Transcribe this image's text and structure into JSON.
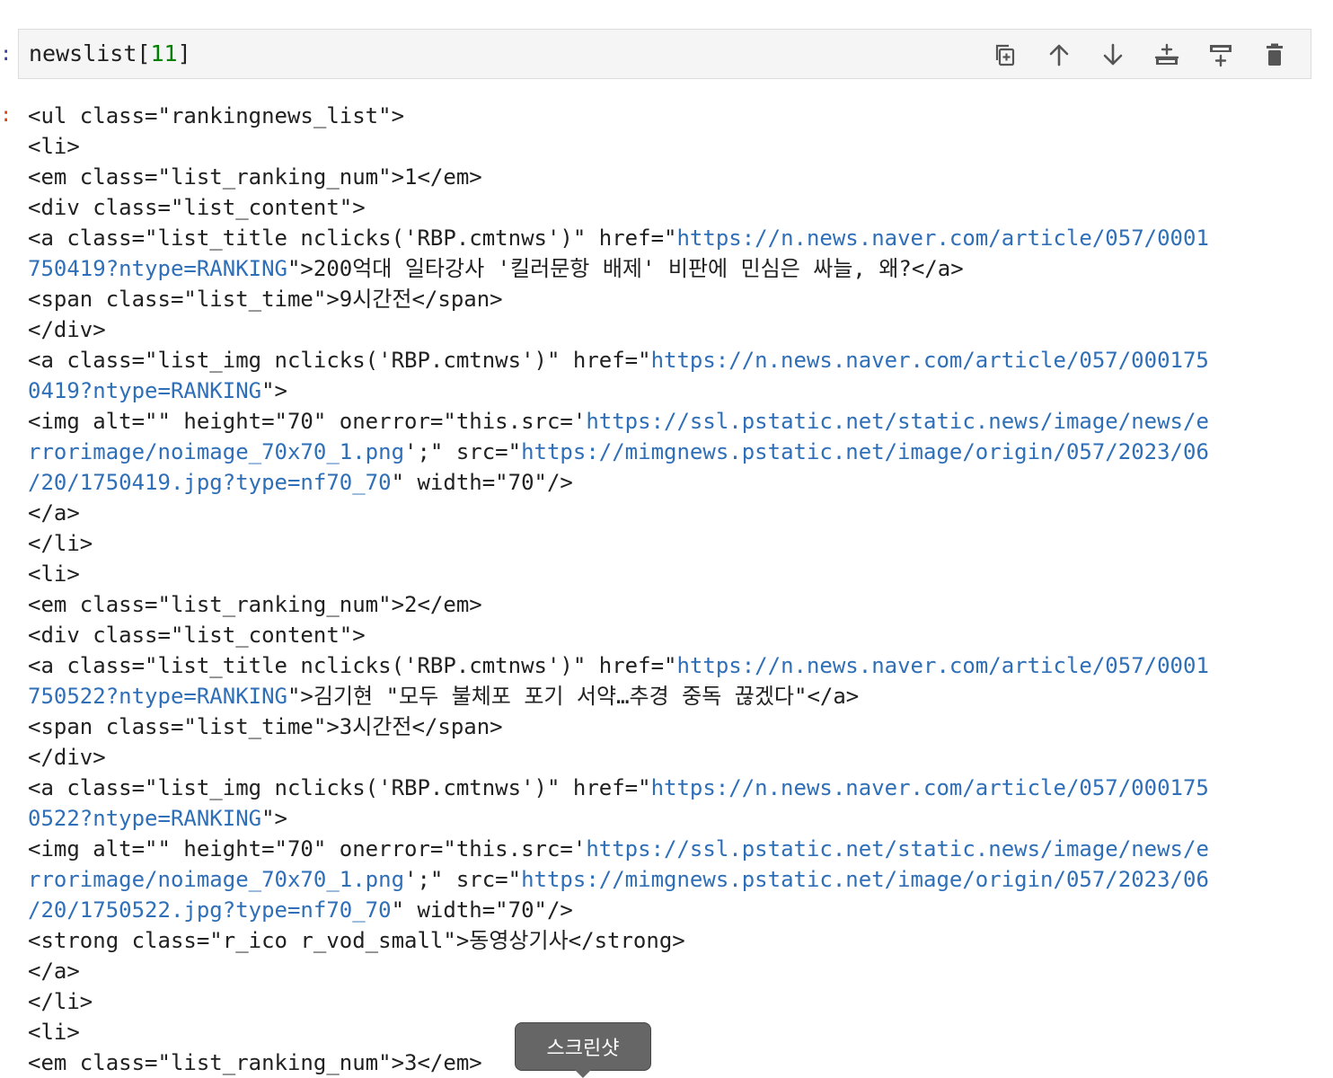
{
  "prompts": {
    "input": ":",
    "output": ":"
  },
  "cell": {
    "code_text": "newslist[",
    "code_index": "11",
    "code_close": "]"
  },
  "toolbar": {
    "buttons": [
      "duplicate-icon",
      "arrow-up-icon",
      "arrow-down-icon",
      "insert-above-icon",
      "insert-below-icon",
      "trash-icon"
    ]
  },
  "output_lines": [
    [
      {
        "t": "<ul class=\"rankingnews_list\">"
      }
    ],
    [
      {
        "t": "<li>"
      }
    ],
    [
      {
        "t": "<em class=\"list_ranking_num\">1</em>"
      }
    ],
    [
      {
        "t": "<div class=\"list_content\">"
      }
    ],
    [
      {
        "t": "<a class=\"list_title nclicks('RBP.cmtnws')\" href=\""
      },
      {
        "t": "https://n.news.naver.com/article/057/0001",
        "link": true
      }
    ],
    [
      {
        "t": "750419?ntype=RANKING",
        "link": true
      },
      {
        "t": "\">200억대 일타강사 '킬러문항 배제' 비판에 민심은 싸늘, 왜?</a>"
      }
    ],
    [
      {
        "t": "<span class=\"list_time\">9시간전</span>"
      }
    ],
    [
      {
        "t": "</div>"
      }
    ],
    [
      {
        "t": "<a class=\"list_img nclicks('RBP.cmtnws')\" href=\""
      },
      {
        "t": "https://n.news.naver.com/article/057/000175",
        "link": true
      }
    ],
    [
      {
        "t": "0419?ntype=RANKING",
        "link": true
      },
      {
        "t": "\">"
      }
    ],
    [
      {
        "t": "<img alt=\"\" height=\"70\" onerror=\"this.src='"
      },
      {
        "t": "https://ssl.pstatic.net/static.news/image/news/e",
        "link": true
      }
    ],
    [
      {
        "t": "rrorimage/noimage_70x70_1.png",
        "link": true
      },
      {
        "t": "';\" src=\""
      },
      {
        "t": "https://mimgnews.pstatic.net/image/origin/057/2023/06",
        "link": true
      }
    ],
    [
      {
        "t": "/20/1750419.jpg?type=nf70_70",
        "link": true
      },
      {
        "t": "\" width=\"70\"/>"
      }
    ],
    [
      {
        "t": "</a>"
      }
    ],
    [
      {
        "t": "</li>"
      }
    ],
    [
      {
        "t": "<li>"
      }
    ],
    [
      {
        "t": "<em class=\"list_ranking_num\">2</em>"
      }
    ],
    [
      {
        "t": "<div class=\"list_content\">"
      }
    ],
    [
      {
        "t": "<a class=\"list_title nclicks('RBP.cmtnws')\" href=\""
      },
      {
        "t": "https://n.news.naver.com/article/057/0001",
        "link": true
      }
    ],
    [
      {
        "t": "750522?ntype=RANKING",
        "link": true
      },
      {
        "t": "\">김기현 \"모두 불체포 포기 서약…추경 중독 끊겠다\"</a>"
      }
    ],
    [
      {
        "t": "<span class=\"list_time\">3시간전</span>"
      }
    ],
    [
      {
        "t": "</div>"
      }
    ],
    [
      {
        "t": "<a class=\"list_img nclicks('RBP.cmtnws')\" href=\""
      },
      {
        "t": "https://n.news.naver.com/article/057/000175",
        "link": true
      }
    ],
    [
      {
        "t": "0522?ntype=RANKING",
        "link": true
      },
      {
        "t": "\">"
      }
    ],
    [
      {
        "t": "<img alt=\"\" height=\"70\" onerror=\"this.src='"
      },
      {
        "t": "https://ssl.pstatic.net/static.news/image/news/e",
        "link": true
      }
    ],
    [
      {
        "t": "rrorimage/noimage_70x70_1.png",
        "link": true
      },
      {
        "t": "';\" src=\""
      },
      {
        "t": "https://mimgnews.pstatic.net/image/origin/057/2023/06",
        "link": true
      }
    ],
    [
      {
        "t": "/20/1750522.jpg?type=nf70_70",
        "link": true
      },
      {
        "t": "\" width=\"70\"/>"
      }
    ],
    [
      {
        "t": "<strong class=\"r_ico r_vod_small\">동영상기사</strong>"
      }
    ],
    [
      {
        "t": "</a>"
      }
    ],
    [
      {
        "t": "</li>"
      }
    ],
    [
      {
        "t": "<li>"
      }
    ],
    [
      {
        "t": "<em class=\"list_ranking_num\">3</em>"
      }
    ]
  ],
  "tooltip": {
    "label": "스크린샷"
  },
  "colors": {
    "link": "#2f6fb8",
    "number": "#008000",
    "in_prompt": "#303f9f",
    "out_prompt": "#d84315"
  }
}
